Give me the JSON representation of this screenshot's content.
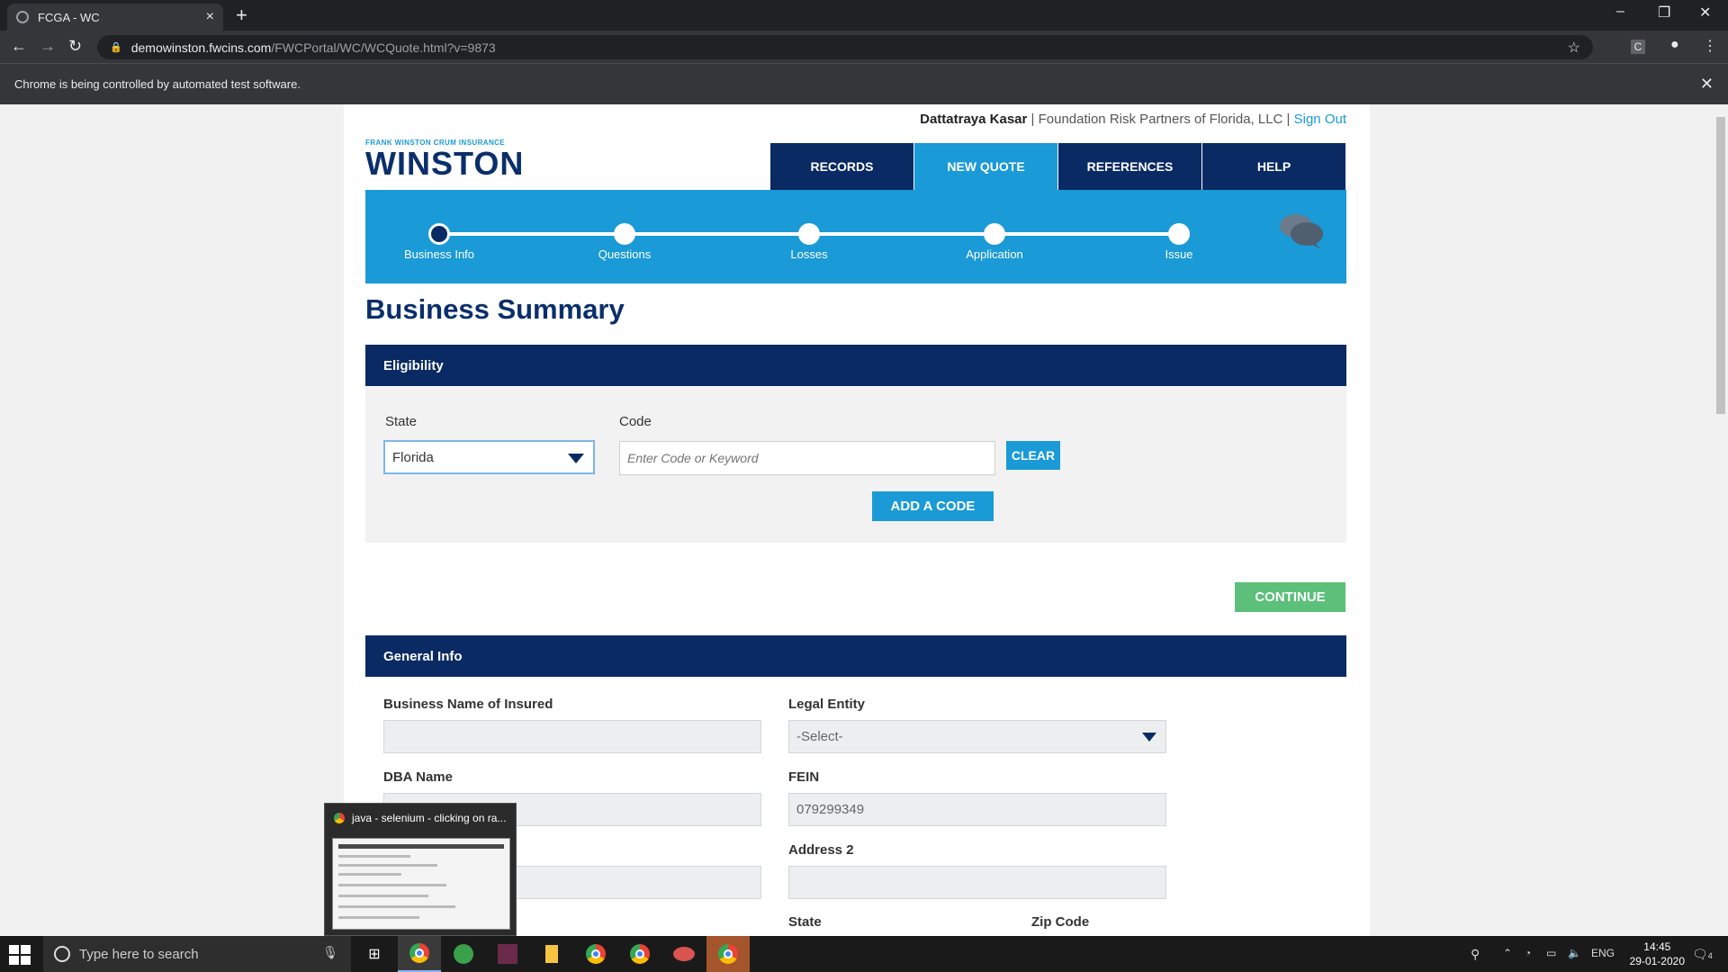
{
  "browser": {
    "tab_title": "FCGA - WC",
    "url_host": "demowinston.fwcins.com",
    "url_path": "/FWCPortal/WC/WCQuote.html?v=9873",
    "infobar_text": "Chrome is being controlled by automated test software."
  },
  "header": {
    "user_name": "Dattatraya Kasar",
    "company": " | Foundation Risk Partners of Florida, LLC | ",
    "sign_out": "Sign Out",
    "logo_small": "FRANK WINSTON CRUM INSURANCE",
    "logo_big": "WINSTON"
  },
  "nav": {
    "items": [
      {
        "label": "RECORDS"
      },
      {
        "label": "NEW QUOTE"
      },
      {
        "label": "REFERENCES"
      },
      {
        "label": "HELP"
      }
    ]
  },
  "progress": {
    "steps": [
      {
        "label": "Business Info"
      },
      {
        "label": "Questions"
      },
      {
        "label": "Losses"
      },
      {
        "label": "Application"
      },
      {
        "label": "Issue"
      }
    ]
  },
  "main": {
    "page_title": "Business Summary",
    "eligibility": {
      "heading": "Eligibility",
      "state_label": "State",
      "state_value": "Florida",
      "code_label": "Code",
      "code_placeholder": "Enter Code or Keyword",
      "clear_label": "CLEAR",
      "add_code_label": "ADD A CODE"
    },
    "continue_label": "CONTINUE",
    "general_info": {
      "heading": "General Info",
      "business_name_label": "Business Name of Insured",
      "legal_entity_label": "Legal Entity",
      "legal_entity_value": "-Select-",
      "dba_label": "DBA Name",
      "fein_label": "FEIN",
      "fein_value": "079299349",
      "address2_label": "Address 2",
      "state_label": "State",
      "zip_label": "Zip Code"
    }
  },
  "thumbnail": {
    "title": "java - selenium - clicking on ra..."
  },
  "taskbar": {
    "search_placeholder": "Type here to search",
    "lang": "ENG",
    "time": "14:45",
    "date": "29-01-2020",
    "notif_count": "4"
  }
}
